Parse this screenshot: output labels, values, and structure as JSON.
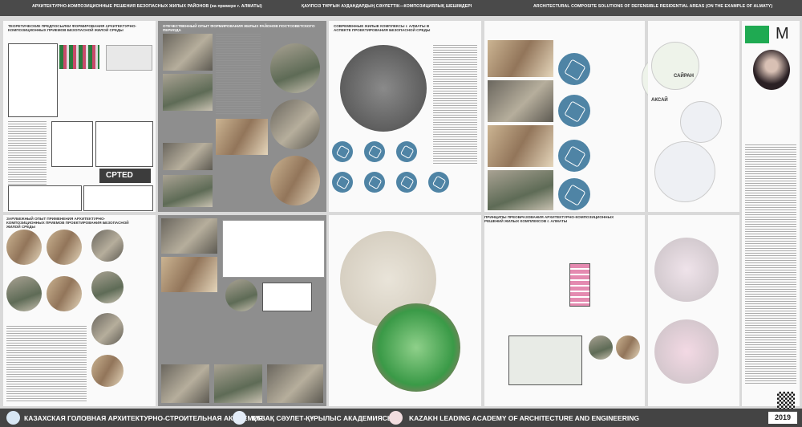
{
  "header": {
    "title_ru": "АРХИТЕКТУРНО-КОМПОЗИЦИОННЫЕ РЕШЕНИЯ БЕЗОПАСНЫХ ЖИЛЫХ РАЙОНОВ (на примере г. АЛМАТЫ)",
    "title_kz": "ҚАУІПСІЗ ТҰРҒЫН АУДАНДАРДЫҢ СӘУЛЕТТІК—КОМПОЗИЦИЯЛЫҚ ШЕШІМДЕРІ",
    "title_en": "ARCHITECTURAL COMPOSITE SOLUTIONS OF DEFENSIBLE RESIDENTIAL AREAS (ON THE EXAMPLE OF ALMATY)"
  },
  "sections": {
    "theory": "ТЕОРЕТИЧЕСКИЕ ПРЕДПОСЫЛКИ ФОРМИРОВАНИЯ АРХИТЕКТУРНО-КОМПОЗИЦИОННЫХ ПРИЕМОВ БЕЗОПАСНОЙ ЖИЛОЙ СРЕДЫ",
    "domestic": "ОТЕЧЕСТВЕННЫЙ ОПЫТ ФОРМИРОВАНИЯ ЖИЛЫХ РАЙОНОВ ПОСТСОВЕТСКОГО ПЕРИОДА",
    "modern": "СОВРЕМЕННЫЕ ЖИЛЫЕ КОМПЛЕКСЫ г. АЛМАТЫ В АСПЕКТЕ ПРОЕКТИРОВАНИЯ БЕЗОПАСНОЙ СРЕДЫ",
    "foreign": "ЗАРУБЕЖНЫЙ ОПЫТ ПРИМЕНЕНИЯ АРХИТЕКТУРНО-КОМПОЗИЦИОННЫХ ПРИЕМОВ ПРОЕКТИРОВАНИЯ БЕЗОПАСНОЙ ЖИЛОЙ СРЕДЫ",
    "principles": "ПРИНЦИПЫ ПРЕОБРАЗОВАНИЯ АРХИТЕКТУРНО-КОМПОЗИЦИОННЫХ РЕШЕНИЙ ЖИЛЫХ КОМПЛЕКСОВ г. АЛМАТЫ",
    "cpted": "CPTED",
    "map_label_1": "САЙРАН",
    "map_label_2": "АКСАЙ",
    "badge_letter": "M"
  },
  "footer": {
    "name_ru": "КАЗАХСКАЯ ГОЛОВНАЯ АРХИТЕКТУРНО-СТРОИТЕЛЬНАЯ АКАДЕМИЯ",
    "name_kz": "ҚАЗАҚ СӘУЛЕТ-ҚҰРЫЛЫС АКАДЕМИЯСЫ",
    "name_en": "KAZAKH LEADING ACADEMY OF ARCHITECTURE AND ENGINEERING",
    "year": "2019"
  },
  "colors": {
    "accent_green": "#1faa52",
    "accent_pink": "#e0558a",
    "accent_blue": "#4f84a5",
    "bar": "#444444"
  }
}
